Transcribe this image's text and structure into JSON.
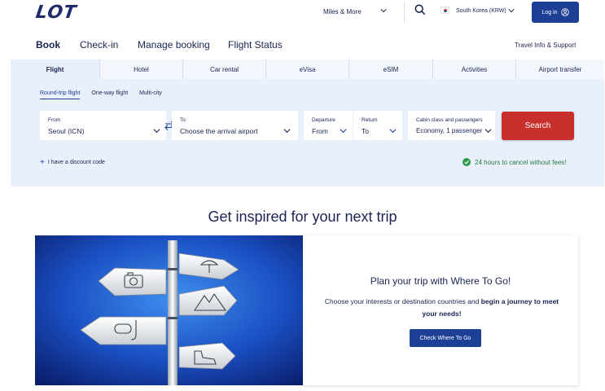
{
  "header": {
    "logo": "LOT",
    "miles_label": "Miles & More",
    "country_label": "South Korea (KRW)",
    "login_label": "Log in"
  },
  "nav": {
    "book": "Book",
    "checkin": "Check-in",
    "manage": "Manage booking",
    "status": "Flight Status",
    "travel_info": "Travel Info & Support"
  },
  "booking": {
    "tabs": [
      {
        "label": "Flight",
        "active": true
      },
      {
        "label": "Hotel",
        "active": false
      },
      {
        "label": "Car rental",
        "active": false
      },
      {
        "label": "eVisa",
        "active": false
      },
      {
        "label": "eSIM",
        "active": false
      },
      {
        "label": "Activities",
        "active": false
      },
      {
        "label": "Airport transfer",
        "active": false
      }
    ],
    "trip_types": [
      {
        "label": "Round-trip flight",
        "active": true
      },
      {
        "label": "One-way flight",
        "active": false
      },
      {
        "label": "Multi-city",
        "active": false
      }
    ],
    "from": {
      "label": "From",
      "value": "Seoul (ICN)"
    },
    "to": {
      "label": "To",
      "placeholder": "Choose the arrival airport"
    },
    "departure": {
      "label": "Departure",
      "placeholder": "From"
    },
    "return": {
      "label": "Return",
      "placeholder": "To"
    },
    "cabin": {
      "label": "Cabin class and passengers",
      "value": "Economy, 1 passenger"
    },
    "search_label": "Search",
    "discount_label": "I have a discount code",
    "cancel_note": "24 hours to cancel without fees!"
  },
  "inspire": {
    "title": "Get inspired for your next trip",
    "card_title": "Plan your trip with Where To Go!",
    "card_text_plain": "Choose your interests or destination countries and ",
    "card_text_bold": "begin a journey to meet your needs!",
    "card_button": "Check Where To Go"
  },
  "colors": {
    "brand_blue": "#1e3f96",
    "navy_text": "#1a2352",
    "search_red": "#c8302c",
    "panel_bg": "#e8f0fc",
    "success_green": "#2a7a3e"
  }
}
